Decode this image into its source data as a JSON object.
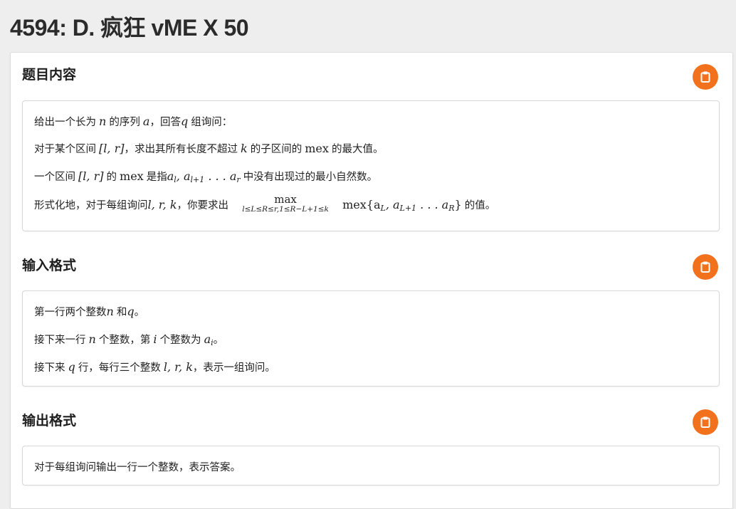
{
  "page_title": "4594: D. 疯狂 vME X 50",
  "sections": [
    {
      "heading": "题目内容",
      "lines": {
        "l1": {
          "a": "给出一个长为",
          "n": "n",
          "b": "的序列",
          "arr": "a",
          "c": "，回答",
          "q": "q",
          "d": "组询问："
        },
        "l2": {
          "a": "对于某个区间",
          "interval": "[l, r]",
          "b": "，求出其所有长度不超过",
          "k": "k",
          "c": "的子区间的",
          "mex": "mex",
          "d": "的最大值。"
        },
        "l3": {
          "a": "一个区间",
          "interval": "[l, r]",
          "b": "的",
          "mex": "mex",
          "c": "是指",
          "seq": "a",
          "seq_sub1": "l",
          "seq_mid": ", a",
          "seq_sub2": "l+1",
          "seq_dots": " . . . a",
          "seq_sub3": "r",
          "d": "中没有出现过的最小自然数。"
        },
        "l4": {
          "a": "形式化地，对于每组询问",
          "vars": "l, r, k",
          "b": "，你要求出",
          "max": "max",
          "max_cond": "l≤L≤R≤r,1≤R−L+1≤k",
          "mex": "mex{a",
          "sub_L": "L",
          "mid": ", a",
          "sub_L1": "L+1",
          "dots": " . . . a",
          "sub_R": "R",
          "close": "}",
          "c": "的值。"
        }
      }
    },
    {
      "heading": "输入格式",
      "lines": {
        "l1": {
          "a": "第一行两个整数",
          "n": "n",
          "b": "和",
          "q": "q",
          "c": "。"
        },
        "l2": {
          "a": "接下来一行",
          "n": "n",
          "b": "个整数，第",
          "i": "i",
          "c": "个整数为",
          "ai": "a",
          "ai_sub": "i",
          "d": "。"
        },
        "l3": {
          "a": "接下来",
          "q": "q",
          "b": "行，每行三个整数",
          "vars": "l, r, k",
          "c": "，表示一组询问。"
        }
      }
    },
    {
      "heading": "输出格式",
      "lines": {
        "l1": {
          "a": "对于每组询问输出一行一个整数，表示答案。"
        }
      }
    }
  ],
  "icons": {
    "copy": "clipboard-icon"
  },
  "colors": {
    "accent": "#f2711c",
    "background": "#eeeeee"
  }
}
